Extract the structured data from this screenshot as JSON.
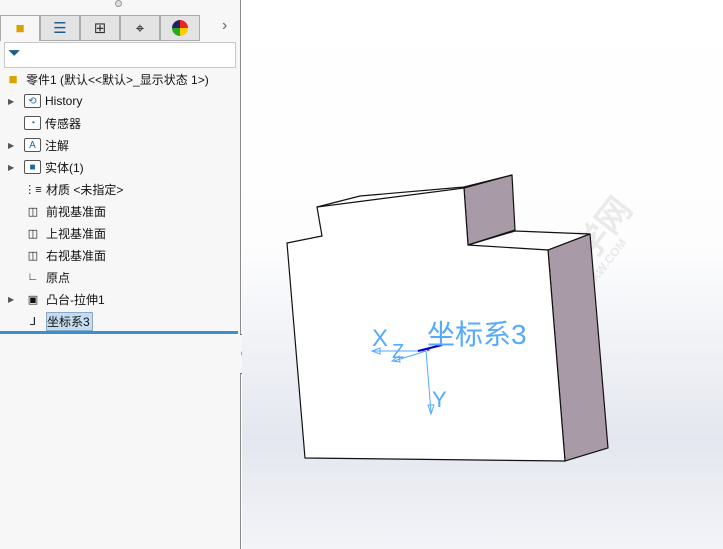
{
  "tabs": [
    {
      "icon": "part-icon",
      "active": true
    },
    {
      "icon": "property-manager-icon"
    },
    {
      "icon": "configuration-manager-icon"
    },
    {
      "icon": "dimxpert-icon"
    },
    {
      "icon": "display-manager-icon"
    }
  ],
  "more_icon": "chevron-right-icon",
  "filter_icon": "funnel-icon",
  "tree": {
    "root": "零件1  (默认<<默认>_显示状态 1>)",
    "items": [
      {
        "label": "History",
        "icon": "history-folder-icon",
        "expandable": true
      },
      {
        "label": "传感器",
        "icon": "sensor-folder-icon",
        "expandable": false
      },
      {
        "label": "注解",
        "icon": "annotation-folder-icon",
        "expandable": true
      },
      {
        "label": "实体(1)",
        "icon": "solid-bodies-folder-icon",
        "expandable": true
      },
      {
        "label": "材质 <未指定>",
        "icon": "material-icon",
        "expandable": false
      },
      {
        "label": "前视基准面",
        "icon": "plane-icon",
        "expandable": false
      },
      {
        "label": "上视基准面",
        "icon": "plane-icon",
        "expandable": false
      },
      {
        "label": "右视基准面",
        "icon": "plane-icon",
        "expandable": false
      },
      {
        "label": "原点",
        "icon": "origin-icon",
        "expandable": false
      },
      {
        "label": "凸台-拉伸1",
        "icon": "extrude-icon",
        "expandable": true
      },
      {
        "label": "坐标系3",
        "icon": "coordinate-system-icon",
        "expandable": false,
        "selected": true
      }
    ]
  },
  "viewport": {
    "csys_label": "坐标系3",
    "axis_x": "X",
    "axis_y": "Y",
    "axis_z": "Z",
    "watermark": "软件自学网",
    "watermark_url": "WWW.RJZXW.COM",
    "colors": {
      "side_face": "#a89aa6",
      "csys": "#55aaff",
      "front_face": "#ffffff"
    }
  }
}
